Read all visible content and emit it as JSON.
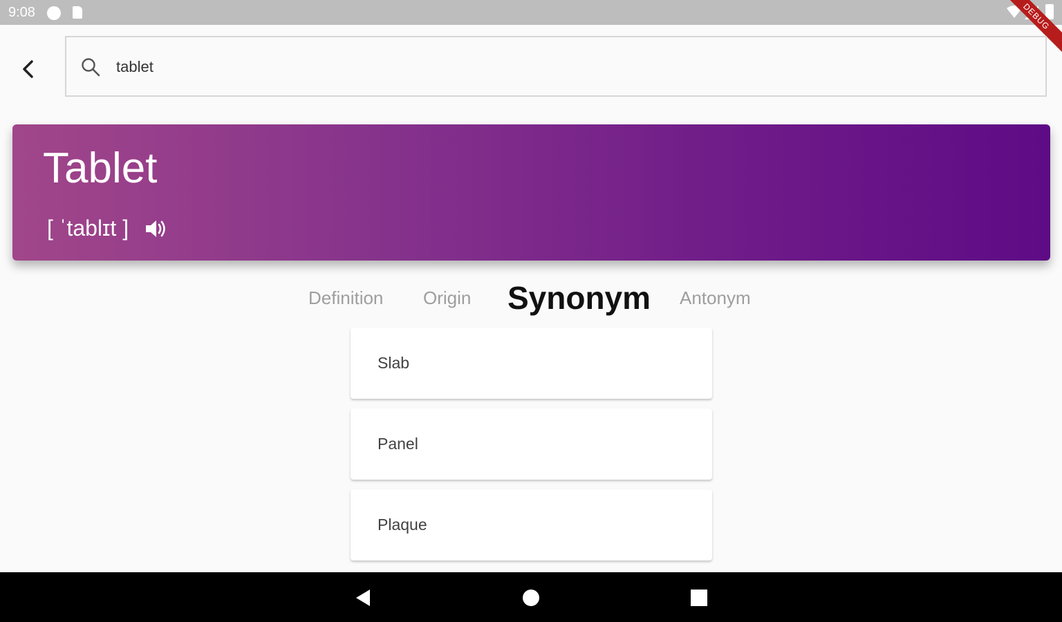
{
  "status_bar": {
    "time": "9:08",
    "debug_banner": "DEBUG"
  },
  "search": {
    "value": "tablet",
    "placeholder": ""
  },
  "word": {
    "title": "Tablet",
    "pronunciation": "[ ˈtablɪt ]"
  },
  "tabs": [
    {
      "label": "Definition"
    },
    {
      "label": "Origin"
    },
    {
      "label": "Synonym"
    },
    {
      "label": "Antonym"
    }
  ],
  "active_tab": "Synonym",
  "synonyms": [
    {
      "text": "Slab"
    },
    {
      "text": "Panel"
    },
    {
      "text": "Plaque"
    }
  ],
  "colors": {
    "header_gradient_start": "#a1468a",
    "header_gradient_end": "#5e0b86",
    "status_bar": "#bdbdbd",
    "nav_bar": "#000000",
    "tab_inactive": "#9e9e9e",
    "tab_active": "#111111"
  },
  "icons": {
    "back": "arrow-back-icon",
    "search": "search-icon",
    "speaker": "volume-up-icon",
    "nav_back": "triangle-back-icon",
    "nav_home": "circle-home-icon",
    "nav_recents": "square-recents-icon"
  }
}
